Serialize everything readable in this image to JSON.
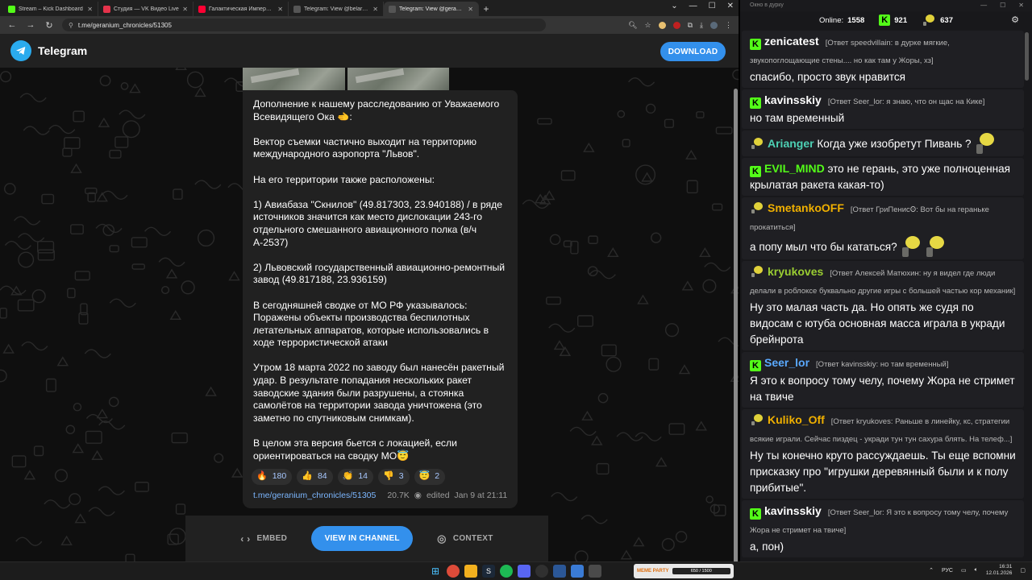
{
  "browser": {
    "tabs": [
      {
        "title": "Stream – Kick Dashboard",
        "favicon_color": "#53fc18"
      },
      {
        "title": "Студия — VK Видео Live",
        "favicon_color": "#e5334b"
      },
      {
        "title": "Галактическая Империя – все...",
        "favicon_color": "#ff0033"
      },
      {
        "title": "Telegram: View @belarusian_si...",
        "favicon_color": "#555555"
      },
      {
        "title": "Telegram: View @geranium_ch...",
        "favicon_color": "#555555"
      }
    ],
    "new_tab": "+",
    "url": "t.me/geranium_chronicles/51305"
  },
  "telegram": {
    "brand": "Telegram",
    "download_label": "DOWNLOAD",
    "post": {
      "paragraphs": [
        "Дополнение к нашему расследованию от Уважаемого Всевидящего Ока 🫲:",
        "Вектор съемки частично выходит на территорию международного аэропорта \"Львов\".",
        "На его территории также расположены:",
        "1) Авиабаза \"Скнилов\" (49.817303, 23.940188) / в ряде источников значится как место дислокации 243-го отдельного смешанного авиационного полка (в/ч А-2537)",
        "2) Львовский государственный авиационно-ремонтный завод (49.817188, 23.936159)",
        "В сегодняшней сводке от МО РФ указывалось: Поражены объекты производства беспилотных летательных аппаратов, которые использовались в ходе террористической атаки",
        "Утром 18 марта 2022 по заводу был нанесён ракетный удар. В результате попадания нескольких ракет заводские здания были разрушены, а стоянка самолётов на территории завода уничтожена (это заметно по спутниковым снимкам).",
        "В целом эта версия бьется с локацией, если ориентироваться на сводку МО😇"
      ],
      "reactions": [
        {
          "emoji": "🔥",
          "count": "180"
        },
        {
          "emoji": "👍",
          "count": "84"
        },
        {
          "emoji": "👏",
          "count": "14"
        },
        {
          "emoji": "👎",
          "count": "3"
        },
        {
          "emoji": "😇",
          "count": "2"
        }
      ],
      "link": "t.me/geranium_chronicles/51305",
      "views": "20.7K",
      "edited": "edited  Jan 9 at 21:11"
    },
    "footer": {
      "embed_label": "EMBED",
      "view_channel_label": "VIEW IN CHANNEL",
      "context_label": "CONTEXT"
    }
  },
  "chat": {
    "window_title": "Окно в дурку",
    "online_label": "Online:",
    "online_count": "1558",
    "kick_count": "921",
    "vk_count": "637",
    "messages": [
      {
        "platform": "kick",
        "user": "zenicatest",
        "color": "#ffffff",
        "reply": "[Ответ speedvillain: в дурке мягкие, звукопоглощающие стены.... но как там у Жоры, хз]",
        "text": "спасибо, просто звук нравится",
        "emotes": 0
      },
      {
        "platform": "kick",
        "user": "kavinsskiy",
        "color": "#ffffff",
        "reply": "[Ответ Seer_lor: я знаю, что он щас на Кике]",
        "text": "но там временный",
        "emotes": 0
      },
      {
        "platform": "vk",
        "user": "Arianger",
        "color": "#4dd0b4",
        "reply": "",
        "text": "Когда уже изобретут Пивань ?",
        "emotes": 1
      },
      {
        "platform": "kick",
        "user": "EVIL_MIND",
        "color": "#53fc18",
        "reply": "",
        "text": "это не герань, это уже полноценная крылатая ракета какая-то)",
        "emotes": 0
      },
      {
        "platform": "vk",
        "user": "SmetankoOFF",
        "color": "#f0b000",
        "reply": "[Ответ ГриПенисꙨ: Вот бы на гераньке прокатиться]",
        "text": "а попу мыл что бы кататься?",
        "emotes": 2
      },
      {
        "platform": "vk",
        "user": "kryukoves",
        "color": "#9acd32",
        "reply": "[Ответ Алексей Матюхин: ну я видел где люди делали в роблоксе буквально другие игры с большей частью кор механик]",
        "text": "Ну это малая часть да. Но опять же судя по видосам с ютуба основная масса играла в укради брейнрота",
        "emotes": 0
      },
      {
        "platform": "kick",
        "user": "Seer_lor",
        "color": "#5aa9ff",
        "reply": "[Ответ kavinsskiy: но там временный]",
        "text": "Я это к вопросу тому челу, почему Жора не стримет на твиче",
        "emotes": 0
      },
      {
        "platform": "vk",
        "user": "Kuliko_Off",
        "color": "#f0b000",
        "reply": "[Ответ kryukoves: Раньше в линейку, кс, стратегии всякие играли. Сейчас пиздец - укради тун тун сахура блять. На телеф...]",
        "text": "Ну ты конечно круто рассуждаешь. Ты еще вспомни присказку про \"игрушки деревянный были и к полу прибитые\".",
        "emotes": 0
      },
      {
        "platform": "kick",
        "user": "kavinsskiy",
        "color": "#ffffff",
        "reply": "[Ответ Seer_lor: Я это к вопросу тому челу, почему Жора не стримет на твиче]",
        "text": "а, пон)",
        "emotes": 0
      }
    ]
  },
  "taskbar": {
    "widget_label": "MEME PARTY",
    "widget_progress": "650 / 1500",
    "lang": "РУС",
    "time": "16:31",
    "date": "12.01.2026"
  },
  "colors": {
    "accent": "#3390ec",
    "kick_green": "#53fc18",
    "telegram_bg": "#0f0f0f",
    "bubble": "#212121"
  }
}
